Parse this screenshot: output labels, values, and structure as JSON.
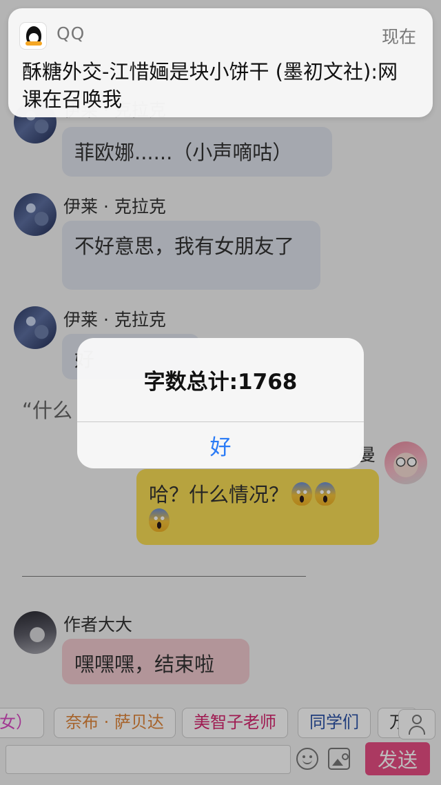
{
  "notification": {
    "app_name": "QQ",
    "time": "现在",
    "body": "酥糖外交-江惜婳是块小饼干 (墨初文社):网课在召唤我"
  },
  "messages": {
    "m1": {
      "name": "伊莱 · 克拉克",
      "text": "菲欧娜......（小声嘀咕）"
    },
    "m2": {
      "name": "伊莱 · 克拉克",
      "text": "不好意思，我有女朋友了"
    },
    "m3": {
      "name": "伊莱 · 克拉克",
      "text": "好"
    },
    "quote": "“什么",
    "m4": {
      "name": "曼",
      "text": "哈？什么情况？"
    },
    "m5": {
      "name": "作者大大",
      "text": "嘿嘿嘿，结束啦"
    }
  },
  "alert": {
    "title": "字数总计:1768",
    "button": "好"
  },
  "tags": [
    {
      "label": "女）",
      "color": "#d94bc4"
    },
    {
      "label": "奈布 · 萨贝达",
      "color": "#e0863a"
    },
    {
      "label": "美智子老师",
      "color": "#d7266f"
    },
    {
      "label": "同学们",
      "color": "#2a52a8"
    },
    {
      "label": "万",
      "color": "#333333"
    }
  ],
  "input": {
    "placeholder": "",
    "send_label": "发送"
  },
  "icons": {
    "emoji": "face-screaming-in-fear",
    "smile": "smile-icon",
    "image": "image-icon",
    "person": "person-icon"
  },
  "colors": {
    "send": "#e74e83",
    "alert_button": "#2a7bf6"
  }
}
